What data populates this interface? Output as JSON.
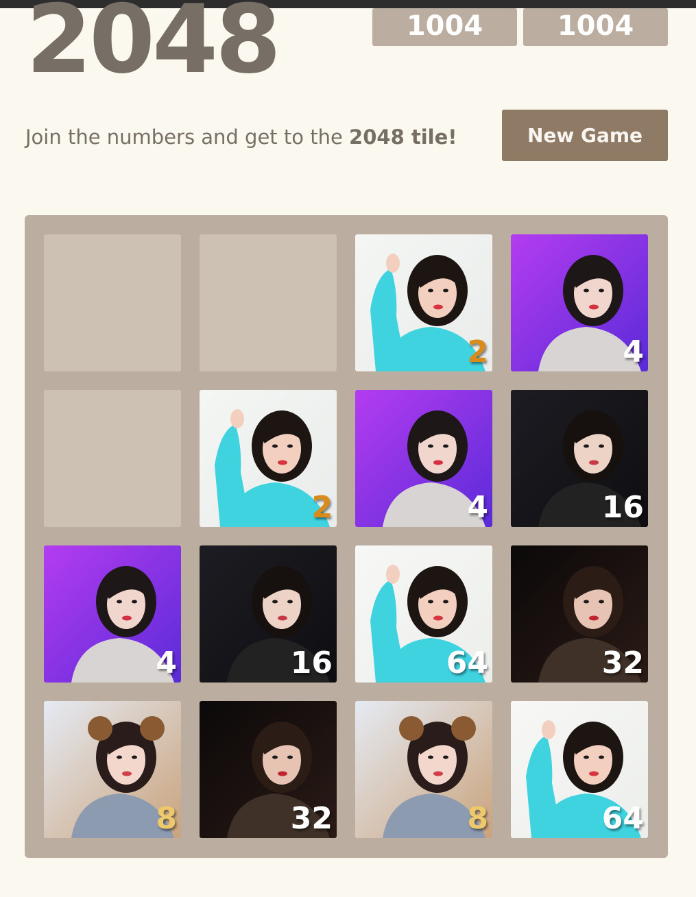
{
  "header": {
    "title": "2048",
    "score": "1004",
    "best": "1004"
  },
  "intro": {
    "prefix": "Join the numbers and get to the ",
    "highlight": "2048 tile!"
  },
  "new_game_label": "New Game",
  "board": {
    "rows": [
      [
        null,
        null,
        2,
        4
      ],
      [
        null,
        2,
        4,
        16
      ],
      [
        4,
        16,
        64,
        32
      ],
      [
        8,
        32,
        8,
        64
      ]
    ]
  },
  "colors": {
    "background": "#faf8ef",
    "board": "#bbada0",
    "empty_cell": "#cdc1b4",
    "text": "#776e65",
    "button": "#8f7a66"
  }
}
